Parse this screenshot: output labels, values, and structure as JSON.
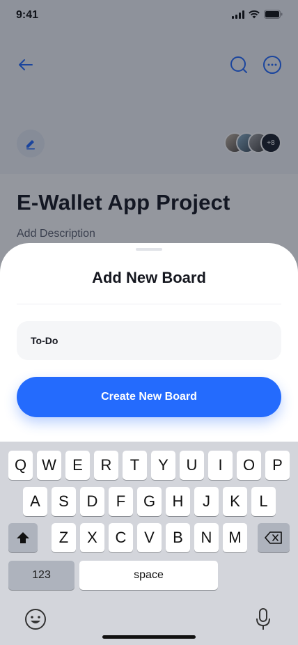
{
  "status_bar": {
    "time": "9:41"
  },
  "header": {
    "back_icon": "arrow-left-icon",
    "search_icon": "search-icon",
    "more_icon": "more-horizontal-icon",
    "edit_icon": "pencil-icon"
  },
  "members": {
    "more_count": "+8"
  },
  "project": {
    "title": "E-Wallet App Project",
    "description": "Add Description"
  },
  "sheet": {
    "title": "Add New Board",
    "input_value": "To-Do",
    "button_label": "Create New Board"
  },
  "keyboard": {
    "row1": [
      "Q",
      "W",
      "E",
      "R",
      "T",
      "Y",
      "U",
      "I",
      "O",
      "P"
    ],
    "row2": [
      "A",
      "S",
      "D",
      "F",
      "G",
      "H",
      "J",
      "K",
      "L"
    ],
    "row3": [
      "Z",
      "X",
      "C",
      "V",
      "B",
      "N",
      "M"
    ],
    "numbers_label": "123",
    "space_label": "space"
  },
  "colors": {
    "accent": "#246bfd",
    "title_text": "#15171f"
  }
}
